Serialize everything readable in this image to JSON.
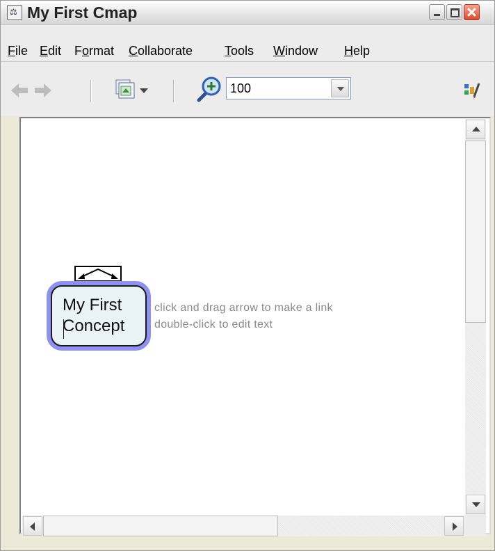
{
  "window": {
    "title": "My First Cmap"
  },
  "menubar": {
    "items": [
      {
        "prefix": "",
        "mnemonic": "F",
        "rest": "ile"
      },
      {
        "prefix": "",
        "mnemonic": "E",
        "rest": "dit"
      },
      {
        "prefix": "F",
        "mnemonic": "o",
        "rest": "rmat"
      },
      {
        "prefix": "",
        "mnemonic": "C",
        "rest": "ollaborate"
      },
      {
        "prefix": "",
        "mnemonic": "T",
        "rest": "ools"
      },
      {
        "prefix": "",
        "mnemonic": "W",
        "rest": "indow"
      },
      {
        "prefix": "",
        "mnemonic": "H",
        "rest": "elp"
      }
    ]
  },
  "toolbar": {
    "zoom_value": "100",
    "icons": [
      "back-arrow-icon",
      "forward-arrow-icon",
      "view-options-icon",
      "zoom-in-icon",
      "styles-palette-icon"
    ]
  },
  "canvas": {
    "concept": {
      "line1": "My First",
      "line2": "Concept"
    },
    "hint_line1": "click and drag arrow to make a link",
    "hint_line2": "double-click to edit text"
  },
  "colors": {
    "concept_highlight": "#8f8ff4",
    "concept_fill": "#eaf3f6",
    "hint_text": "#8a8a8a",
    "close_button": "#e04b2a"
  }
}
